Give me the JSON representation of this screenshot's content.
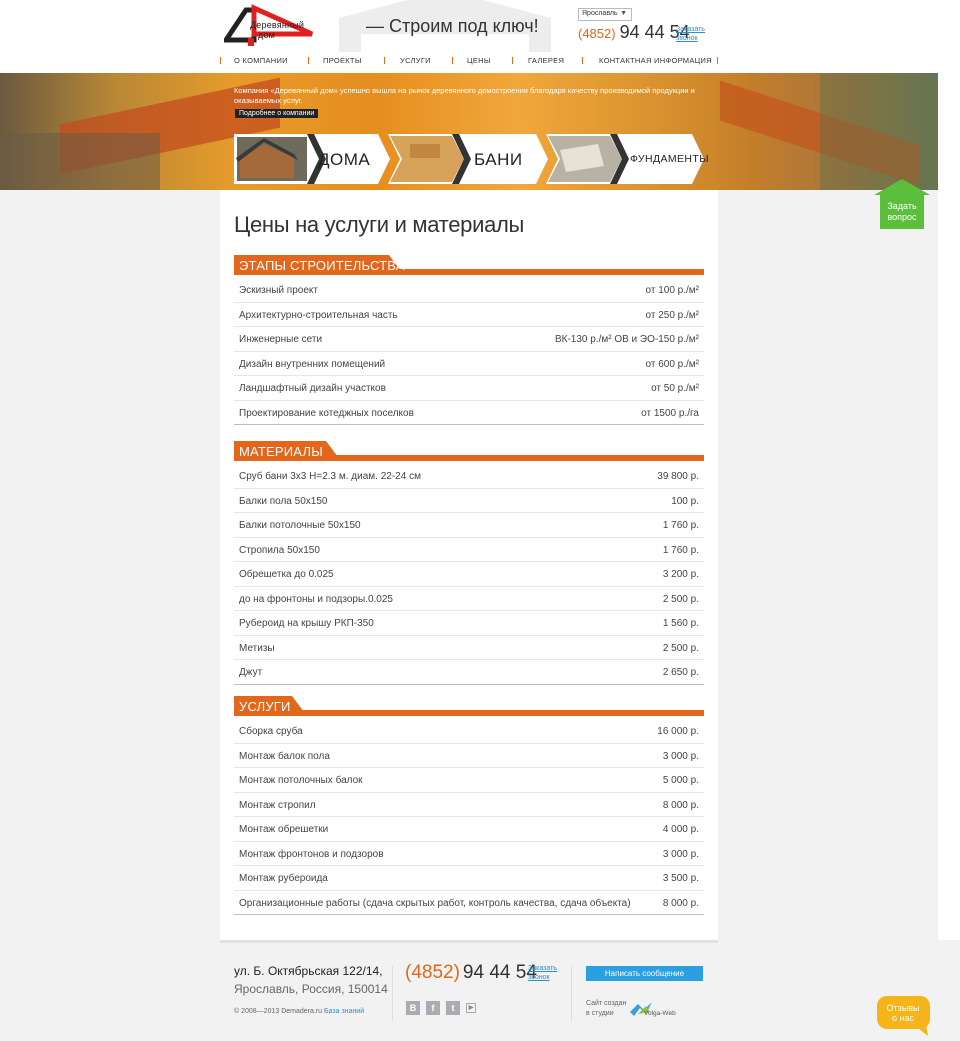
{
  "header": {
    "logo_line1": "Деревянный",
    "logo_line2": "дом",
    "tagline": "— Строим под ключ!",
    "city": "Ярославль",
    "phone_code": "(4852)",
    "phone_number": "94 44 54",
    "callback_line1": "Заказать",
    "callback_line2": "звонок"
  },
  "nav": [
    "О КОМПАНИИ",
    "ПРОЕКТЫ",
    "УСЛУГИ",
    "ЦЕНЫ",
    "ГАЛЕРЕЯ",
    "КОНТАКТНАЯ ИНФОРМАЦИЯ"
  ],
  "banner": {
    "text": "Компания «Деревянный дом» успешно вышла на рынок деревянного домостроения благодаря качеству производимой продукции и оказываемых услуг.",
    "more_label": "Подробнее о компании",
    "categories": [
      "ДОМА",
      "БАНИ",
      "ФУНДАМЕНТЫ"
    ]
  },
  "ask": {
    "line1": "Задать",
    "line2": "вопрос"
  },
  "main": {
    "title": "Цены на услуги и материалы",
    "sections": [
      {
        "title": "ЭТАПЫ СТРОИТЕЛЬСТВА",
        "rows": [
          {
            "name": "Эскизный проект",
            "price": "от 100 р./м²"
          },
          {
            "name": "Архитектурно-строительная часть",
            "price": "от 250 р./м²"
          },
          {
            "name": "Инженерные сети",
            "price": "ВК-130 р./м² ОВ и ЭО-150 р./м²"
          },
          {
            "name": "Дизайн внутренних помещений",
            "price": "от 600 р./м²"
          },
          {
            "name": "Ландшафтный дизайн участков",
            "price": "от 50 р./м²"
          },
          {
            "name": "Проектирование котеджных поселков",
            "price": "от 1500 р./га"
          }
        ]
      },
      {
        "title": "МАТЕРИАЛЫ",
        "rows": [
          {
            "name": "Сруб бани 3х3 Н=2.3 м. диам. 22-24 см",
            "price": "39 800 р."
          },
          {
            "name": "Балки пола 50х150",
            "price": "100 р."
          },
          {
            "name": "Балки потолочные 50х150",
            "price": "1 760 р."
          },
          {
            "name": "Стропила 50х150",
            "price": "1 760 р."
          },
          {
            "name": "Обрешетка до 0.025",
            "price": "3 200 р."
          },
          {
            "name": "до на фронтоны и подзоры.0.025",
            "price": "2 500 р."
          },
          {
            "name": "Рубероид на крышу РКП-350",
            "price": "1 560 р."
          },
          {
            "name": "Метизы",
            "price": "2 500 р."
          },
          {
            "name": "Джут",
            "price": "2 650 р."
          }
        ]
      },
      {
        "title": "УСЛУГИ",
        "rows": [
          {
            "name": "Сборка сруба",
            "price": "16 000 р."
          },
          {
            "name": "Монтаж балок пола",
            "price": "3 000 р."
          },
          {
            "name": "Монтаж потолочных балок",
            "price": "5 000 р."
          },
          {
            "name": "Монтаж стропил",
            "price": "8 000 р."
          },
          {
            "name": "Монтаж обрешетки",
            "price": "4 000 р."
          },
          {
            "name": "Монтаж фронтонов и подзоров",
            "price": "3 000 р."
          },
          {
            "name": "Монтаж рубероида",
            "price": "3 500 р."
          },
          {
            "name": "Организационные работы (сдача скрытых работ, контроль качества, сдача объекта)",
            "price": "8 000 р."
          }
        ]
      }
    ]
  },
  "footer": {
    "address_line1": "ул. Б. Октябрьская 122/14,",
    "address_line2": "Ярославль, Россия, 150014",
    "copyright": "© 2008—2013 Demadera.ru",
    "knowledge_link": "База знаний",
    "phone_code": "(4852)",
    "phone_number": "94 44 54",
    "callback_line1": "Заказать",
    "callback_line2": "звонок",
    "social_icons": [
      "vk-icon",
      "facebook-icon",
      "twitter-icon",
      "youtube-icon"
    ],
    "message_button": "Написать сообщение",
    "made_line1": "Сайт создан",
    "made_line2": "в студии",
    "studio": "Volga-Web"
  },
  "reviews": {
    "line1": "Отзывы",
    "line2": "о нас"
  },
  "colors": {
    "accent": "#e2661b",
    "link": "#2c8fd0",
    "green": "#5cbf3c",
    "yellow": "#f4b41a",
    "button_blue": "#2ba0e0"
  }
}
